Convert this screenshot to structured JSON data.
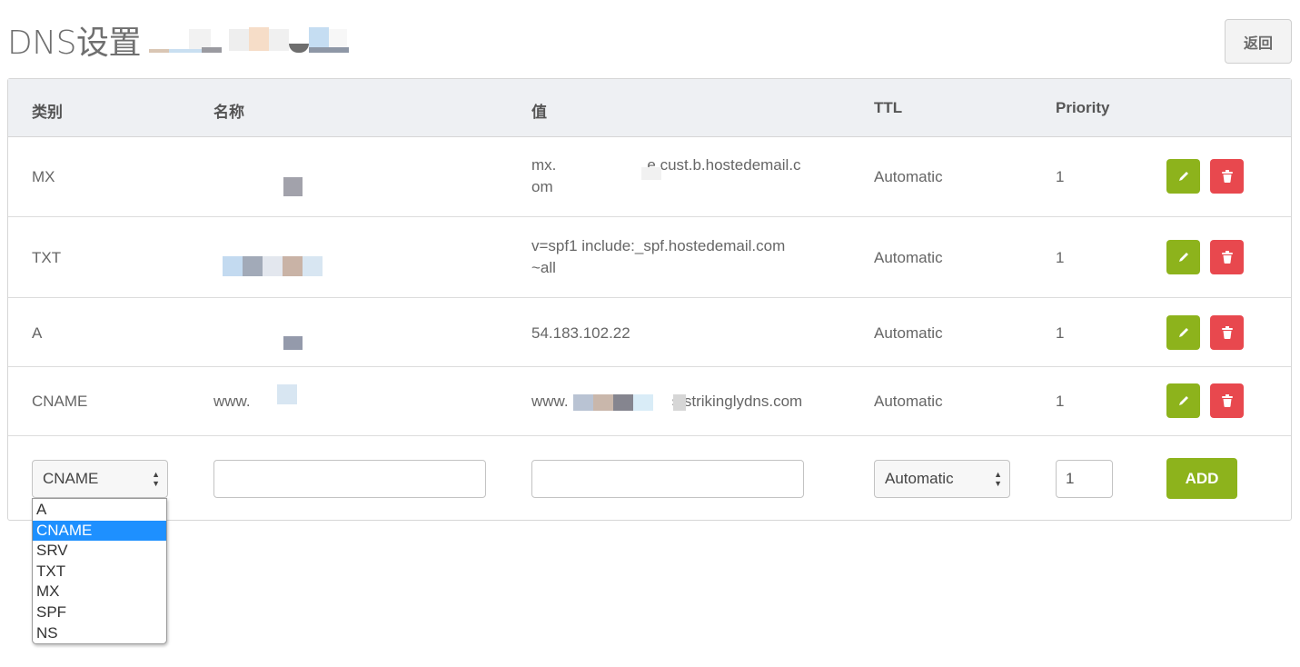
{
  "page": {
    "title": "DNS设置",
    "back_label": "返回"
  },
  "table": {
    "headers": [
      "类别",
      "名称",
      "值",
      "TTL",
      "Priority"
    ],
    "rows": [
      {
        "type": "MX",
        "name": "",
        "value_line1": "mx.",
        "value_line2": "e.cust.b.hostedemail.c",
        "value_line3": "om",
        "ttl": "Automatic",
        "priority": "1"
      },
      {
        "type": "TXT",
        "name": "",
        "value_line1": "v=spf1 include:_spf.hostedemail.com",
        "value_line2": "~all",
        "ttl": "Automatic",
        "priority": "1"
      },
      {
        "type": "A",
        "name": "",
        "value": "54.183.102.22",
        "ttl": "Automatic",
        "priority": "1"
      },
      {
        "type": "CNAME",
        "name": "www.",
        "value_prefix": "www.",
        "value_suffix": "s.strikinglydns.com",
        "ttl": "Automatic",
        "priority": "1"
      }
    ]
  },
  "new_record": {
    "type_selected": "CNAME",
    "name_value": "",
    "value_value": "",
    "ttl_selected": "Automatic",
    "priority_value": "1",
    "add_label": "ADD"
  },
  "type_dropdown": {
    "options": [
      "A",
      "CNAME",
      "SRV",
      "TXT",
      "MX",
      "SPF",
      "NS"
    ],
    "selected_index": 1
  },
  "colors": {
    "edit_button": "#8db31c",
    "delete_button": "#e8484e",
    "add_button": "#8db31c",
    "dropdown_highlight": "#1e90ff",
    "header_bg": "#eef0f3"
  },
  "icons": {
    "edit": "pencil-icon",
    "delete": "trash-icon",
    "select_arrows": "updown-arrows-icon"
  }
}
